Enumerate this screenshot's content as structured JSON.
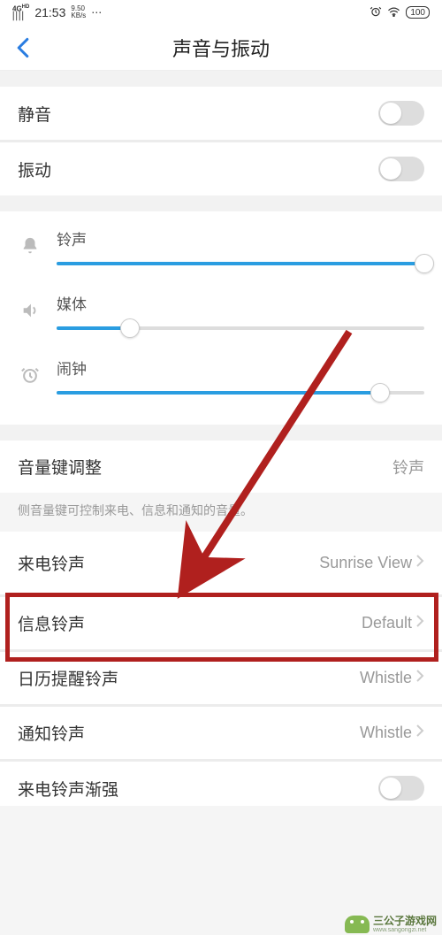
{
  "status": {
    "net": "4G HD",
    "signal": "ıııl",
    "time": "21:53",
    "speed_top": "9.50",
    "speed_bot": "KB/s",
    "dots": "⋯",
    "alarm_icon": "⏰",
    "wifi_icon": "wifi",
    "battery": "100"
  },
  "header": {
    "title": "声音与振动"
  },
  "toggles": {
    "silent": "静音",
    "vibrate": "振动"
  },
  "sliders": {
    "ringtone": {
      "label": "铃声",
      "value": 100
    },
    "media": {
      "label": "媒体",
      "value": 20
    },
    "alarm": {
      "label": "闹钟",
      "value": 88
    }
  },
  "volkey": {
    "label": "音量键调整",
    "value": "铃声",
    "hint": "侧音量键可控制来电、信息和通知的音量。"
  },
  "ringtones": {
    "incoming": {
      "label": "来电铃声",
      "value": "Sunrise View"
    },
    "message": {
      "label": "信息铃声",
      "value": "Default"
    },
    "calendar": {
      "label": "日历提醒铃声",
      "value": "Whistle"
    },
    "notify": {
      "label": "通知铃声",
      "value": "Whistle"
    },
    "crescendo": {
      "label": "来电铃声渐强"
    }
  },
  "watermark": {
    "title": "三公子游戏网",
    "url": "www.sangongzi.net"
  }
}
